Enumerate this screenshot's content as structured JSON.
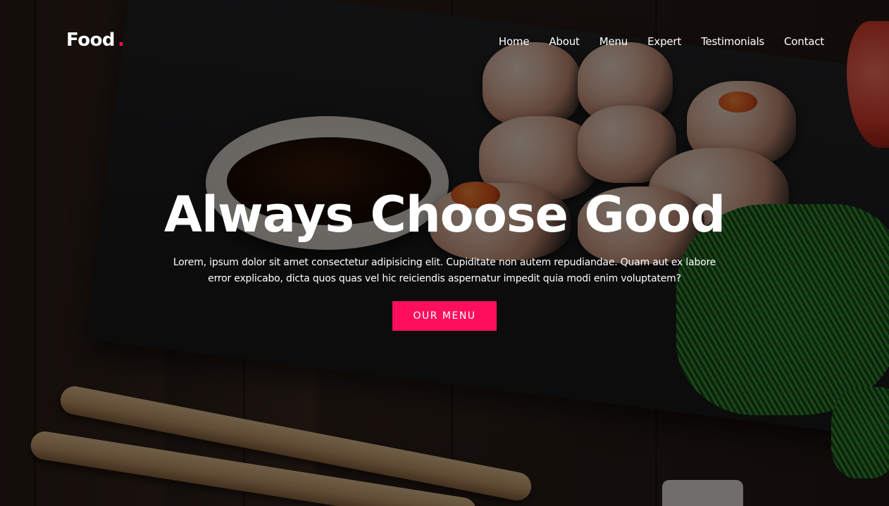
{
  "header": {
    "logo": {
      "text": "Food",
      "dot": "."
    },
    "nav": [
      {
        "label": "Home"
      },
      {
        "label": "About"
      },
      {
        "label": "Menu"
      },
      {
        "label": "Expert"
      },
      {
        "label": "Testimonials"
      },
      {
        "label": "Contact"
      }
    ]
  },
  "hero": {
    "headline": "Always Choose Good",
    "description": "Lorem, ipsum dolor sit amet consectetur adipisicing elit. Cupiditate non autem repudiandae. Quam aut ex labore error explicabo, dicta quos quas vel hic reiciendis aspernatur impedit quia modi enim voluptatem?",
    "cta_label": "OUR MENU"
  },
  "colors": {
    "accent": "#ff0e5e",
    "text": "#ffffff"
  }
}
